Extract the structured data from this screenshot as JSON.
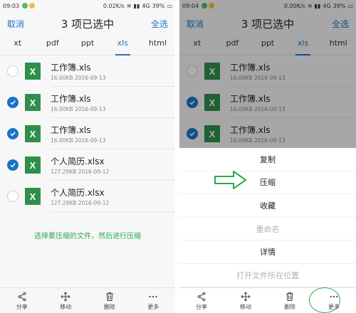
{
  "left": {
    "status": {
      "time": "09:03",
      "speed": "0.02K/s",
      "network": "4G",
      "battery": "39%"
    },
    "nav": {
      "cancel": "取消",
      "title": "3 项已选中",
      "select_all": "全选"
    },
    "tabs": [
      "xt",
      "pdf",
      "ppt",
      "xls",
      "html"
    ],
    "active_tab": "xls",
    "files": [
      {
        "name": "工作簿.xls",
        "size": "16.00KB",
        "date": "2016-09-13",
        "checked": false,
        "icon": "X"
      },
      {
        "name": "工作簿.xls",
        "size": "16.00KB",
        "date": "2016-09-13",
        "checked": true,
        "icon": "X"
      },
      {
        "name": "工作簿.xls",
        "size": "16.00KB",
        "date": "2016-09-13",
        "checked": true,
        "icon": "X"
      },
      {
        "name": "个人简历.xlsx",
        "size": "127.29KB",
        "date": "2016-09-12",
        "checked": true,
        "icon": "X"
      },
      {
        "name": "个人简历.xlsx",
        "size": "127.29KB",
        "date": "2016-09-12",
        "checked": false,
        "icon": "X"
      }
    ],
    "caption": "选择要压缩的文件，然后进行压缩",
    "bottom": [
      {
        "label": "分享",
        "icon": "share-icon"
      },
      {
        "label": "移动",
        "icon": "move-icon"
      },
      {
        "label": "删除",
        "icon": "delete-icon"
      },
      {
        "label": "更多",
        "icon": "more-icon"
      }
    ]
  },
  "right": {
    "status": {
      "time": "09:04",
      "speed": "0.00K/s",
      "network": "4G",
      "battery": "39%"
    },
    "nav": {
      "cancel": "取消",
      "title": "3 项已选中",
      "select_all": "全选"
    },
    "tabs": [
      "xt",
      "pdf",
      "ppt",
      "xls",
      "html"
    ],
    "active_tab": "xls",
    "files": [
      {
        "name": "工作簿.xls",
        "size": "16.00KB",
        "date": "2016-09-13",
        "checked": false,
        "icon": "X"
      },
      {
        "name": "工作簿.xls",
        "size": "16.00KB",
        "date": "2016-09-13",
        "checked": true,
        "icon": "X"
      },
      {
        "name": "工作簿.xls",
        "size": "16.00KB",
        "date": "2016-09-13",
        "checked": true,
        "icon": "X"
      }
    ],
    "menu": [
      {
        "label": "复制",
        "enabled": true
      },
      {
        "label": "压缩",
        "enabled": true
      },
      {
        "label": "收藏",
        "enabled": true
      },
      {
        "label": "重命名",
        "enabled": false
      },
      {
        "label": "详情",
        "enabled": true
      },
      {
        "label": "打开文件所在位置",
        "enabled": false
      }
    ],
    "bottom": [
      {
        "label": "分享",
        "icon": "share-icon"
      },
      {
        "label": "移动",
        "icon": "move-icon"
      },
      {
        "label": "删除",
        "icon": "delete-icon"
      },
      {
        "label": "更多",
        "icon": "more-icon"
      }
    ]
  },
  "colors": {
    "accent": "#1a73c8",
    "excel_green": "#2f8f4a",
    "annotation_green": "#2ba84a"
  }
}
